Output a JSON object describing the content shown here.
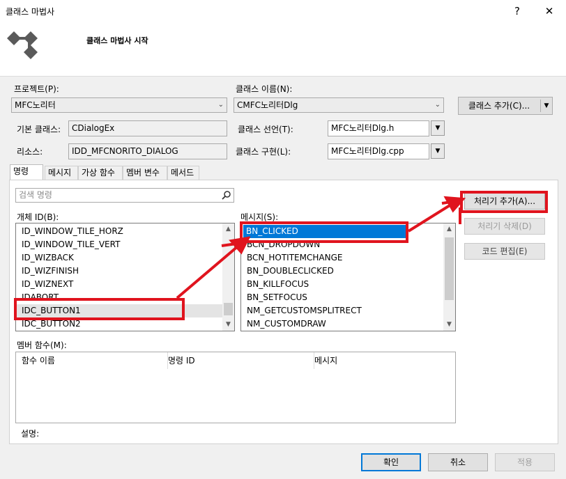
{
  "window": {
    "title": "클래스 마법사",
    "help": "?",
    "close": "✕"
  },
  "header": {
    "title": "클래스 마법사 시작"
  },
  "project": {
    "label": "프로젝트(P):",
    "value": "MFC노리터"
  },
  "class_name": {
    "label": "클래스 이름(N):",
    "value": "CMFC노리터Dlg"
  },
  "add_class_button": {
    "label": "클래스 추가(C)..."
  },
  "base_class": {
    "label": "기본 클래스:",
    "value": "CDialogEx"
  },
  "class_decl": {
    "label": "클래스 선언(T):",
    "value": "MFC노리터Dlg.h"
  },
  "resource": {
    "label": "리소스:",
    "value": "IDD_MFCNORITO_DIALOG"
  },
  "class_impl": {
    "label": "클래스 구현(L):",
    "value": "MFC노리터Dlg.cpp"
  },
  "tabs": [
    "명령",
    "메시지",
    "가상 함수",
    "멤버 변수",
    "메서드"
  ],
  "search": {
    "placeholder": "검색 명령"
  },
  "object_ids": {
    "label": "개체 ID(B):",
    "items": [
      "ID_WINDOW_TILE_HORZ",
      "ID_WINDOW_TILE_VERT",
      "ID_WIZBACK",
      "ID_WIZFINISH",
      "ID_WIZNEXT",
      "IDABORT",
      "IDC_BUTTON1",
      "IDC_BUTTON2"
    ],
    "selected": "IDC_BUTTON1"
  },
  "messages": {
    "label": "메시지(S):",
    "items": [
      "BN_CLICKED",
      "BCN_DROPDOWN",
      "BCN_HOTITEMCHANGE",
      "BN_DOUBLECLICKED",
      "BN_KILLFOCUS",
      "BN_SETFOCUS",
      "NM_GETCUSTOMSPLITRECT",
      "NM_CUSTOMDRAW"
    ],
    "selected": "BN_CLICKED"
  },
  "side_buttons": {
    "add_handler": "처리기 추가(A)...",
    "delete_handler": "처리기 삭제(D)",
    "edit_code": "코드 편집(E)"
  },
  "member_functions": {
    "label": "멤버 함수(M):",
    "columns": [
      "함수 이름",
      "명령 ID",
      "메시지"
    ]
  },
  "description": {
    "label": "설명:"
  },
  "footer": {
    "ok": "확인",
    "cancel": "취소",
    "apply": "적용"
  },
  "colors": {
    "selection": "#0078d7",
    "annotation": "#e0141e"
  }
}
